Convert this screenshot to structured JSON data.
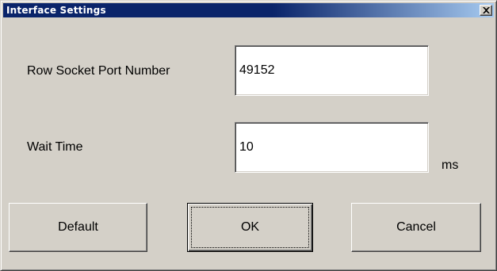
{
  "window": {
    "title": "Interface Settings",
    "close_icon": "close-icon"
  },
  "fields": {
    "port": {
      "label": "Row Socket Port Number",
      "value": "49152"
    },
    "wait": {
      "label": "Wait Time",
      "value": "10",
      "unit": "ms"
    }
  },
  "buttons": {
    "default_label": "Default",
    "ok_label": "OK",
    "cancel_label": "Cancel"
  },
  "colors": {
    "titlebar_start": "#0a246a",
    "titlebar_end": "#a6caf0",
    "face": "#d4d0c8"
  }
}
